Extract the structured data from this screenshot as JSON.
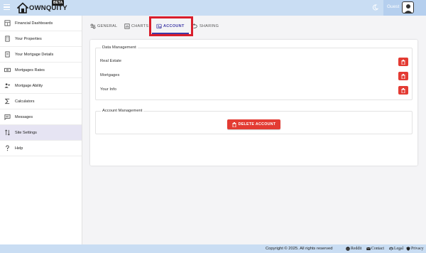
{
  "header": {
    "logo_text": "OWNQUITY",
    "beta_label": "BETA",
    "guest_label": "Guest"
  },
  "sidebar": {
    "items": [
      {
        "label": "Financial Dashboards",
        "icon": "calculator-grid-icon"
      },
      {
        "label": "Your Properties",
        "icon": "building-icon"
      },
      {
        "label": "Your Mortgage Details",
        "icon": "document-icon"
      },
      {
        "label": "Mortgages Rates",
        "icon": "money-icon"
      },
      {
        "label": "Mortgage Ability",
        "icon": "people-icon"
      },
      {
        "label": "Calculators",
        "icon": "sigma-icon"
      },
      {
        "label": "Messages",
        "icon": "message-icon"
      },
      {
        "label": "Site Settings",
        "icon": "sort-arrows-icon",
        "active": true
      },
      {
        "label": "Help",
        "icon": "question-icon"
      }
    ]
  },
  "tabs": [
    {
      "label": "GENERAL",
      "icon": "sliders-icon"
    },
    {
      "label": "CHARTS",
      "icon": "chart-icon"
    },
    {
      "label": "ACCOUNT",
      "icon": "account-settings-icon",
      "active": true
    },
    {
      "label": "SHARING",
      "icon": "share-icon"
    }
  ],
  "data_management": {
    "legend": "Data Management",
    "rows": [
      {
        "label": "Real Estate"
      },
      {
        "label": "Mortgages"
      },
      {
        "label": "Your Info"
      }
    ]
  },
  "account_management": {
    "legend": "Account Management",
    "delete_label": "DELETE ACCOUNT"
  },
  "footer": {
    "copyright": "Copyright © 2025. All rights reserved",
    "links": [
      {
        "label": "Reddit",
        "icon": "reddit-icon"
      },
      {
        "label": "Contact",
        "icon": "mail-icon"
      },
      {
        "label": "Legal",
        "icon": "scale-icon"
      },
      {
        "label": "Privacy",
        "icon": "shield-icon"
      }
    ]
  },
  "colors": {
    "topbar": "#c9ddf3",
    "accent": "#3f3aa6",
    "danger": "#e33b33",
    "highlight": "#d91e2c"
  }
}
